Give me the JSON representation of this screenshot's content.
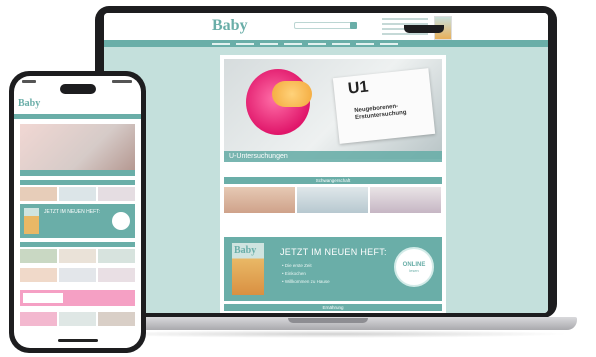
{
  "site": {
    "logo": "Baby",
    "nav_count": 8
  },
  "hero": {
    "card_title": "U1",
    "card_subtitle": "Neugeborenen-Erstuntersuchung",
    "caption": "U-Untersuchungen"
  },
  "sections": {
    "first": "Schwangerschaft",
    "second": "Ernährung"
  },
  "magazine": {
    "logo": "Baby",
    "headline": "JETZT IM NEUEN HEFT:",
    "bullets": [
      "• Die erste Zeit",
      "• Einkochen",
      "• Willkommen zu Hause"
    ],
    "badge": "ONLINE",
    "badge_sub": "lesen"
  },
  "phone": {
    "logo": "Baby",
    "magazine_headline": "JETZT IM NEUEN HEFT:"
  },
  "colors": {
    "accent": "#6aaea8",
    "background_tint": "#c4e0dc",
    "pacifier": "#e0166a"
  }
}
